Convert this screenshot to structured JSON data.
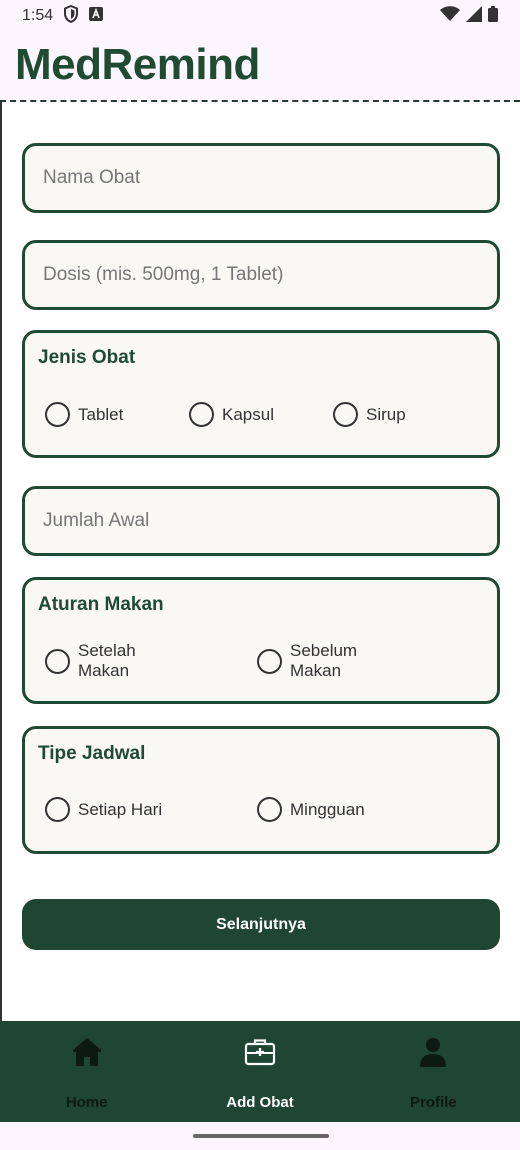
{
  "status_bar": {
    "time": "1:54",
    "icons": [
      "shield-icon",
      "font-icon",
      "wifi-icon",
      "signal-icon",
      "battery-icon"
    ]
  },
  "app": {
    "title": "MedRemind"
  },
  "form": {
    "nama_obat": {
      "placeholder": "Nama Obat",
      "value": ""
    },
    "dosis": {
      "placeholder": "Dosis (mis. 500mg, 1 Tablet)",
      "value": ""
    },
    "jenis_obat": {
      "title": "Jenis Obat",
      "options": [
        "Tablet",
        "Kapsul",
        "Sirup"
      ],
      "selected": null
    },
    "jumlah_awal": {
      "placeholder": "Jumlah Awal",
      "value": ""
    },
    "aturan_makan": {
      "title": "Aturan Makan",
      "options": [
        "Setelah Makan",
        "Sebelum Makan"
      ],
      "selected": null
    },
    "tipe_jadwal": {
      "title": "Tipe Jadwal",
      "options": [
        "Setiap Hari",
        "Mingguan"
      ],
      "selected": null
    },
    "next_button": "Selanjutnya"
  },
  "bottom_nav": {
    "items": [
      {
        "label": "Home",
        "icon": "home-icon",
        "active": false
      },
      {
        "label": "Add Obat",
        "icon": "medkit-icon",
        "active": true
      },
      {
        "label": "Profile",
        "icon": "person-icon",
        "active": false
      }
    ]
  },
  "colors": {
    "primary": "#1f4533",
    "title": "#1f4a33",
    "field_bg": "#faf8f3",
    "header_bg": "#fbf6fc"
  }
}
